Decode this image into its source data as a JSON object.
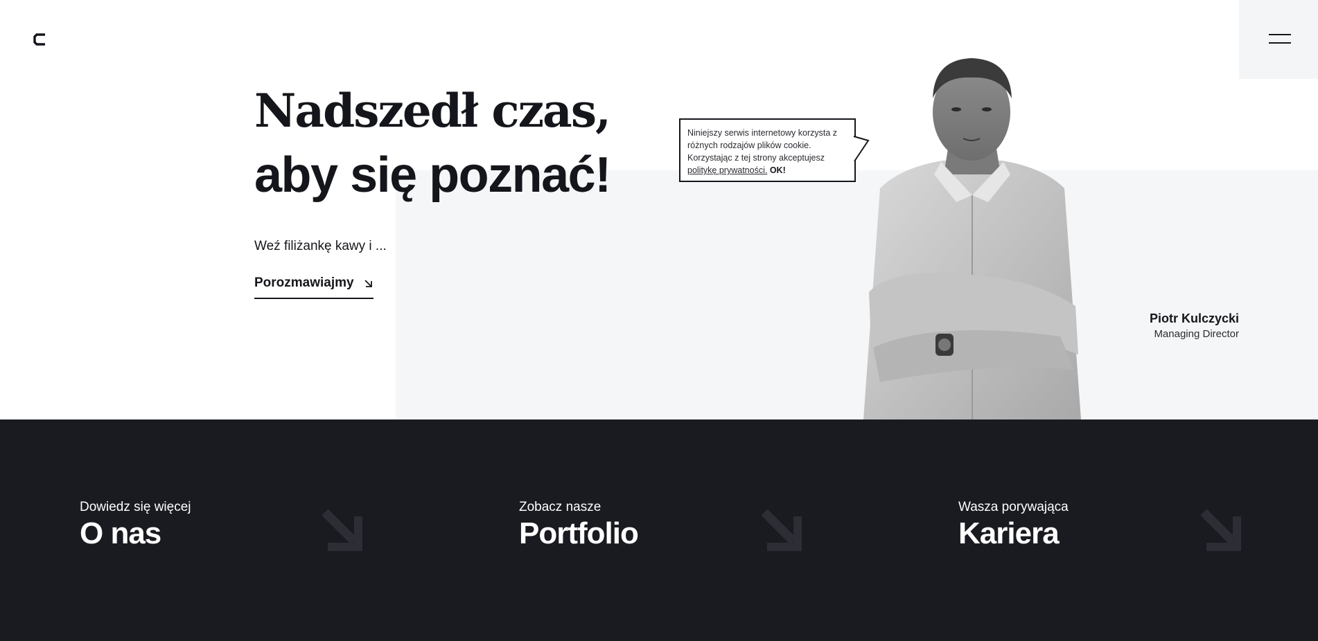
{
  "brand": {
    "logo_icon": "c-logo-icon"
  },
  "menu": {
    "icon": "hamburger-menu-icon"
  },
  "hero": {
    "headline_line1": "Nadszedł czas,",
    "headline_line2": "aby się poznać!",
    "subtext": "Weź filiżankę kawy i ...",
    "cta_label": "Porozmawiajmy",
    "cta_icon": "arrow-down-right-icon"
  },
  "cookie": {
    "text": "Niniejszy serwis internetowy korzysta z różnych rodzajów plików cookie. Korzystając z tej strony akceptujesz",
    "link_label": "politykę prywatności.",
    "ok_label": "OK!"
  },
  "person": {
    "name": "Piotr Kulczycki",
    "role": "Managing Director"
  },
  "cards": [
    {
      "pre": "Dowiedz się więcej",
      "title": "O nas",
      "icon": "arrow-down-right-icon"
    },
    {
      "pre": "Zobacz nasze",
      "title": "Portfolio",
      "icon": "arrow-down-right-icon"
    },
    {
      "pre": "Wasza porywająca",
      "title": "Kariera",
      "icon": "arrow-down-right-icon"
    }
  ],
  "colors": {
    "dark": "#1a1b21",
    "text": "#15161b",
    "light_panel": "#f5f6f8",
    "arrow_muted": "#2c2d35"
  }
}
